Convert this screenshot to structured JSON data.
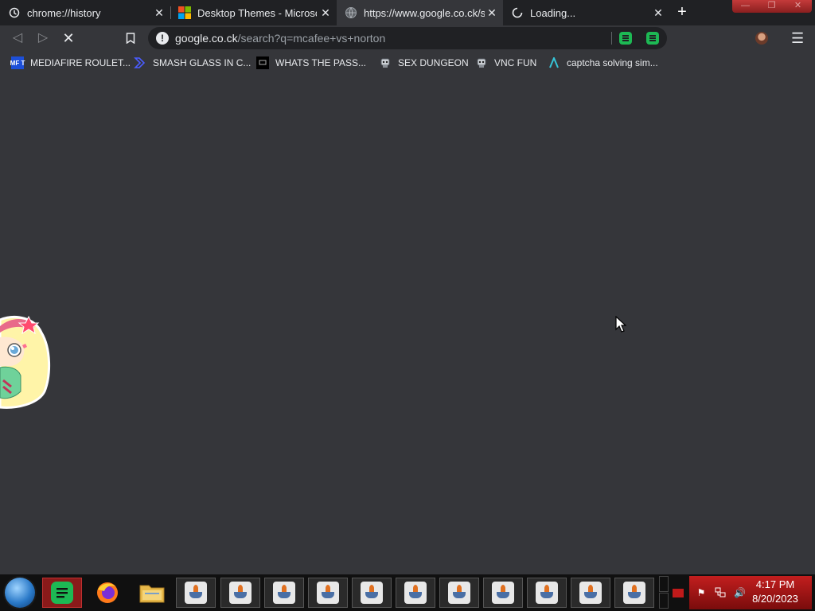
{
  "tabs": [
    {
      "title": "chrome://history",
      "icon": "history-icon",
      "active": false
    },
    {
      "title": "Desktop Themes - Microsoft",
      "icon": "microsoft-logo-icon",
      "active": false
    },
    {
      "title": "https://www.google.co.ck/se",
      "icon": "globe-icon",
      "active": true
    },
    {
      "title": "Loading...",
      "icon": "loading-spinner-icon",
      "active": false
    }
  ],
  "toolbar": {
    "url_host": "google.co.ck",
    "url_path": "/search?q=mcafee+vs+norton"
  },
  "bookmarks": [
    {
      "label": "MEDIAFIRE ROULET...",
      "icon": "mediafire-icon",
      "icon_text": "MF T"
    },
    {
      "label": "SMASH GLASS IN C...",
      "icon": "chevron-bookmark-icon"
    },
    {
      "label": "WHATS THE PASS...",
      "icon": "terminal-icon"
    },
    {
      "label": "SEX DUNGEON",
      "icon": "robot-icon"
    },
    {
      "label": "VNC FUN",
      "icon": "robot-icon"
    },
    {
      "label": "captcha solving sim...",
      "icon": "lambda-icon"
    }
  ],
  "taskbar": {
    "pinned": [
      "start-orb",
      "spotify",
      "firefox",
      "file-explorer"
    ],
    "java_windows": 11,
    "clock_time": "4:17 PM",
    "clock_date": "8/20/2023"
  },
  "colors": {
    "page_bg": "#35363a",
    "tabstrip_bg": "#202124",
    "taskbar_bg": "#101010",
    "tray_red": "#c21e1e"
  }
}
